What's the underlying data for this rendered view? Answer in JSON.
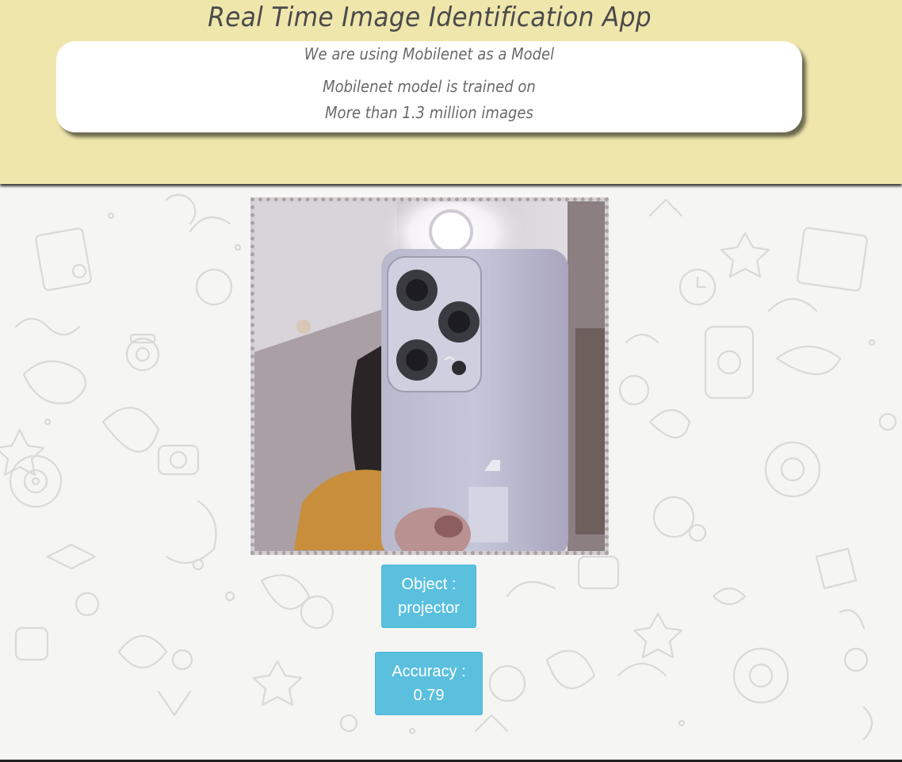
{
  "header": {
    "title": "Real Time Image Identification App",
    "background_color": "#efe6ac"
  },
  "info": {
    "line1": "We are using Mobilenet as a Model",
    "line2": "Mobilenet model is trained on",
    "line3": "More than 1.3 million images"
  },
  "camera": {
    "label": "webcam-feed"
  },
  "result": {
    "object_label": "Object :",
    "object_value": "projector",
    "accuracy_label": "Accuracy :",
    "accuracy_value": "0.79",
    "badge_color": "#5bc0de"
  }
}
